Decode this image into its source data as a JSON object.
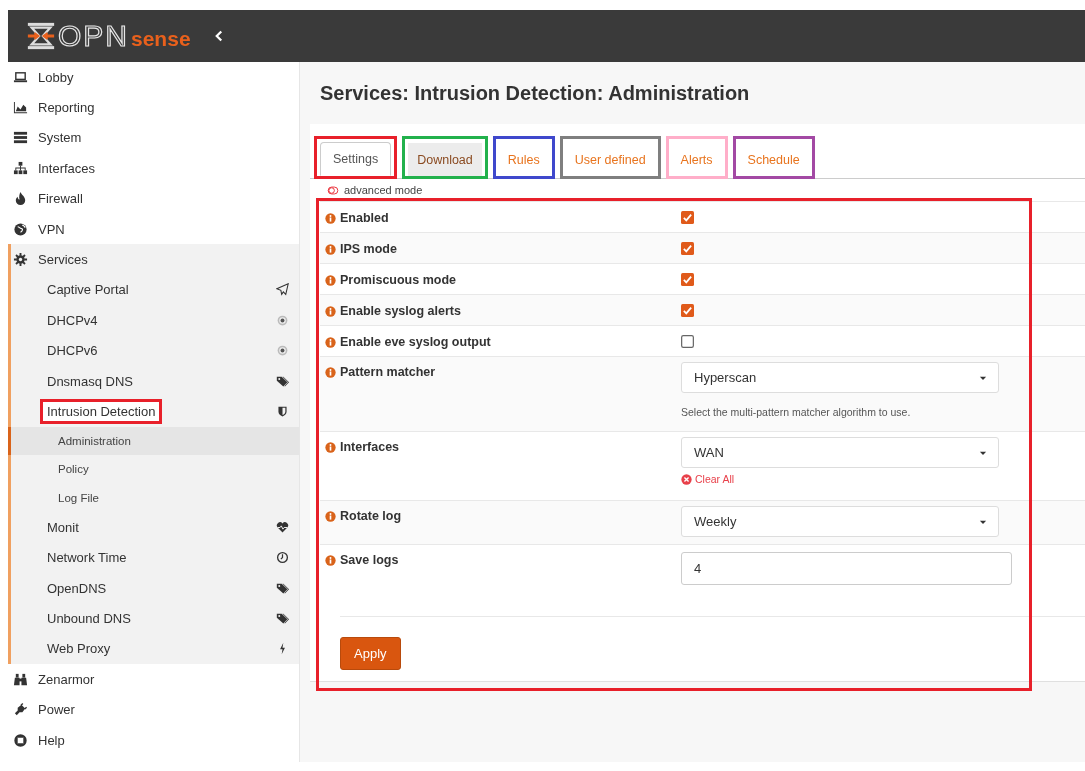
{
  "header": {
    "logo_text": "OPN",
    "logo_accent": "sense"
  },
  "sidebar": {
    "items": [
      {
        "label": "Lobby",
        "expanded": false
      },
      {
        "label": "Reporting",
        "expanded": false
      },
      {
        "label": "System",
        "expanded": false
      },
      {
        "label": "Interfaces",
        "expanded": false
      },
      {
        "label": "Firewall",
        "expanded": false
      },
      {
        "label": "VPN",
        "expanded": false
      },
      {
        "label": "Services",
        "expanded": true,
        "children": [
          {
            "label": "Captive Portal",
            "highlighted": false
          },
          {
            "label": "DHCPv4",
            "highlighted": false
          },
          {
            "label": "DHCPv6",
            "highlighted": false
          },
          {
            "label": "Dnsmasq DNS",
            "highlighted": false
          },
          {
            "label": "Intrusion Detection",
            "highlighted": true,
            "children": [
              {
                "label": "Administration",
                "selected": true
              },
              {
                "label": "Policy",
                "selected": false
              },
              {
                "label": "Log File",
                "selected": false
              }
            ]
          },
          {
            "label": "Monit",
            "highlighted": false
          },
          {
            "label": "Network Time",
            "highlighted": false
          },
          {
            "label": "OpenDNS",
            "highlighted": false
          },
          {
            "label": "Unbound DNS",
            "highlighted": false
          },
          {
            "label": "Web Proxy",
            "highlighted": false
          }
        ]
      },
      {
        "label": "Zenarmor",
        "expanded": false
      },
      {
        "label": "Power",
        "expanded": false
      },
      {
        "label": "Help",
        "expanded": false
      }
    ]
  },
  "page_title": "Services: Intrusion Detection: Administration",
  "tabs": [
    {
      "label": "Settings",
      "selected": true,
      "hovered": false,
      "color": "#e8202a"
    },
    {
      "label": "Download",
      "selected": false,
      "hovered": true,
      "color": "#22b14c"
    },
    {
      "label": "Rules",
      "selected": false,
      "hovered": false,
      "color": "#3f48cc"
    },
    {
      "label": "User defined",
      "selected": false,
      "hovered": false,
      "color": "#7f7f7f"
    },
    {
      "label": "Alerts",
      "selected": false,
      "hovered": false,
      "color": "#ffaec9"
    },
    {
      "label": "Schedule",
      "selected": false,
      "hovered": false,
      "color": "#a349a4"
    }
  ],
  "advanced_mode": {
    "label": "advanced mode",
    "on": false
  },
  "form": {
    "highlighted": true,
    "rows": [
      {
        "kind": "checkbox",
        "label": "Enabled",
        "checked": true
      },
      {
        "kind": "checkbox",
        "label": "IPS mode",
        "checked": true
      },
      {
        "kind": "checkbox",
        "label": "Promiscuous mode",
        "checked": true
      },
      {
        "kind": "checkbox",
        "label": "Enable syslog alerts",
        "checked": true
      },
      {
        "kind": "checkbox",
        "label": "Enable eve syslog output",
        "checked": false
      },
      {
        "kind": "select",
        "label": "Pattern matcher",
        "value": "Hyperscan",
        "help": "Select the multi-pattern matcher algorithm to use."
      },
      {
        "kind": "select",
        "label": "Interfaces",
        "value": "WAN",
        "clear_link": "Clear All"
      },
      {
        "kind": "select",
        "label": "Rotate log",
        "value": "Weekly"
      },
      {
        "kind": "text",
        "label": "Save logs",
        "value": "4"
      }
    ],
    "apply_button": "Apply"
  }
}
